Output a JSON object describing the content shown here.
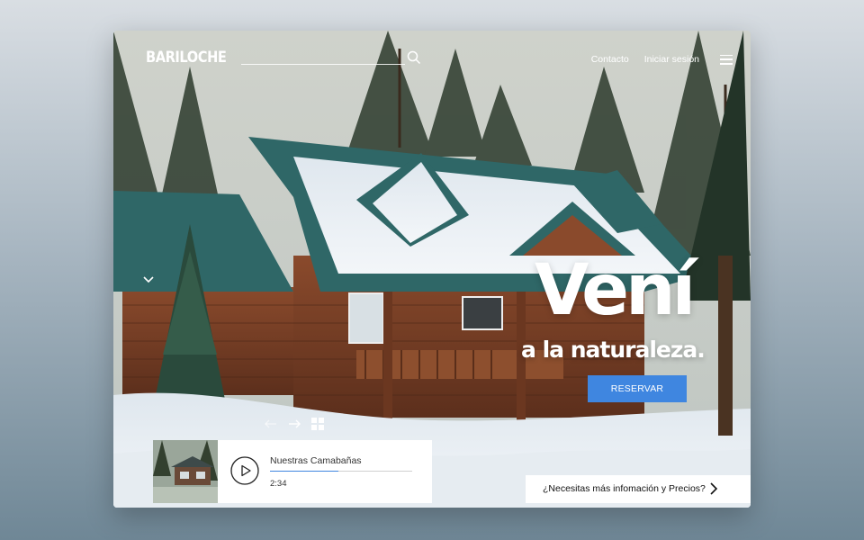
{
  "header": {
    "brand": "BARILOCHE",
    "search_placeholder": "",
    "nav": [
      "Contacto",
      "Iniciar sesión"
    ]
  },
  "hero": {
    "title": "Vení",
    "subtitle": "a la naturaleza.",
    "cta_label": "RESERVAR"
  },
  "video": {
    "title": "Nuestras Camabañas",
    "duration": "2:34",
    "progress": 0.48
  },
  "info_bar": {
    "label": "¿Necesitas más infomación y Precios?"
  },
  "icons": {
    "search": "search-icon",
    "menu": "hamburger-menu-icon",
    "scroll_down": "chevron-down-icon",
    "prev": "arrow-left-icon",
    "next": "arrow-right-icon",
    "grid": "grid-icon",
    "play": "play-icon",
    "info_arrow": "chevron-right-icon"
  },
  "colors": {
    "accent": "#3f86e0",
    "roof": "#2f6767",
    "logs": "#7a4128",
    "snow": "#eef3f7"
  }
}
